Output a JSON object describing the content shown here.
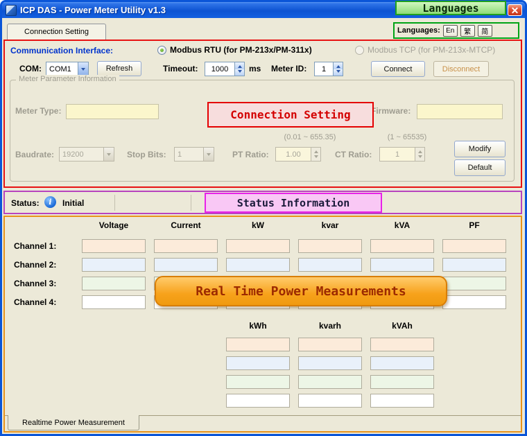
{
  "window": {
    "title": "ICP DAS  -  Power Meter Utility v1.3"
  },
  "callouts": {
    "languages": "Languages",
    "connection": "Connection Setting",
    "status": "Status Information",
    "realtime": "Real Time Power Measurements"
  },
  "tabs": {
    "top": "Connection Setting",
    "bottom": "Realtime Power Measurement"
  },
  "languages_bar": {
    "label": "Languages:",
    "en": "En",
    "tc": "繁",
    "sc": "简"
  },
  "communication": {
    "label": "Communication Interface:",
    "modbus_rtu": "Modbus RTU (for PM-213x/PM-311x)",
    "modbus_tcp": "Modbus TCP (for PM-213x-MTCP)",
    "com_label": "COM:",
    "com_value": "COM1",
    "refresh": "Refresh",
    "timeout_label": "Timeout:",
    "timeout_value": "1000",
    "ms_label": "ms",
    "meter_id_label": "Meter ID:",
    "meter_id_value": "1",
    "connect": "Connect",
    "disconnect": "Disconnect"
  },
  "meter_params": {
    "title": "Meter Parameter Information",
    "meter_type_label": "Meter Type:",
    "firmware_label": "Firmware:",
    "pt_range": "(0.01 ~ 655.35)",
    "ct_range": "(1 ~ 65535)",
    "baudrate_label": "Baudrate:",
    "baudrate_value": "19200",
    "stop_bits_label": "Stop Bits:",
    "stop_bits_value": "1",
    "pt_ratio_label": "PT Ratio:",
    "pt_ratio_value": "1.00",
    "ct_ratio_label": "CT Ratio:",
    "ct_ratio_value": "1",
    "modify": "Modify",
    "default": "Default"
  },
  "status_bar": {
    "label": "Status:",
    "info_glyph": "i",
    "value": "Initial"
  },
  "measurements": {
    "columns": [
      "Voltage",
      "Current",
      "kW",
      "kvar",
      "kVA",
      "PF"
    ],
    "channels": [
      "Channel 1:",
      "Channel 2:",
      "Channel 3:",
      "Channel 4:"
    ],
    "energy_columns": [
      "kWh",
      "kvarh",
      "kVAh"
    ]
  },
  "colors": {
    "connection_section_border": "#E81212",
    "status_section_border": "#B844BE",
    "measurement_section_border": "#E8921A",
    "languages_callout_border": "#1FA01F",
    "channel1_field": "#FCEBDA",
    "channel2_field": "#E9F1FA",
    "channel3_field": "#EDF6E6",
    "channel4_field": "#FFFFFF"
  }
}
